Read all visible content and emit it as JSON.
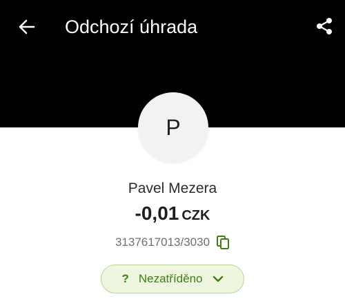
{
  "header": {
    "title": "Odchozí úhrada",
    "background": "#000000",
    "back_icon": "arrow-left-icon",
    "share_icon": "share-icon"
  },
  "counterparty": {
    "avatar_letter": "P",
    "name": "Pavel Mezera"
  },
  "transaction": {
    "amount": "-0,01",
    "currency": "CZK",
    "account_number": "3137617013/3030",
    "copy_icon": "copy-icon"
  },
  "category": {
    "icon_glyph": "?",
    "label": "Nezatříděno",
    "accent": "#3f7d12",
    "chip_background": "#eef6df",
    "chevron_icon": "chevron-down-icon"
  }
}
